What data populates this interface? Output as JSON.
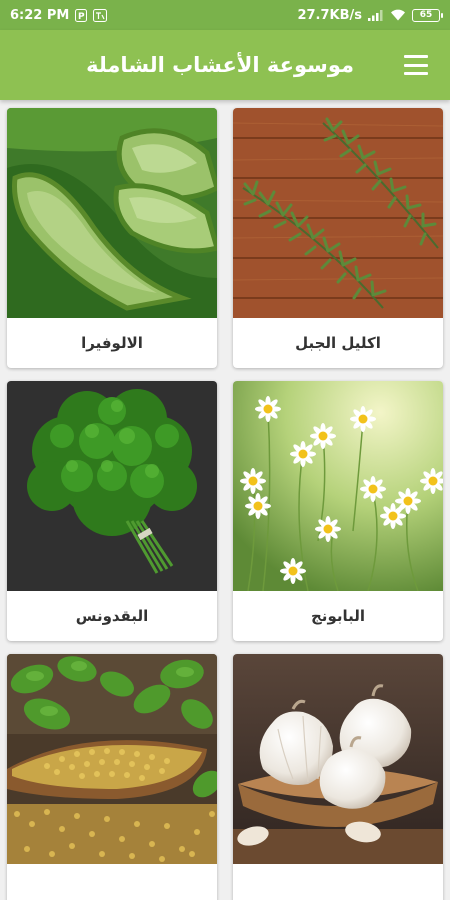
{
  "status": {
    "time": "6:22 PM",
    "net_speed": "27.7KB/s",
    "battery": "65"
  },
  "app_bar": {
    "title": "موسوعة الأعشاب الشاملة"
  },
  "herbs": [
    {
      "name": "اكليل الجبل",
      "icon": "rosemary-image"
    },
    {
      "name": "الالوفيرا",
      "icon": "aloe-vera-image"
    },
    {
      "name": "البابونج",
      "icon": "chamomile-image"
    },
    {
      "name": "البقدونس",
      "icon": "parsley-image"
    },
    {
      "name": "",
      "icon": "garlic-image"
    },
    {
      "name": "",
      "icon": "fenugreek-image"
    }
  ],
  "colors": {
    "status_bar": "#7ab24b",
    "app_bar": "#8ec152"
  }
}
